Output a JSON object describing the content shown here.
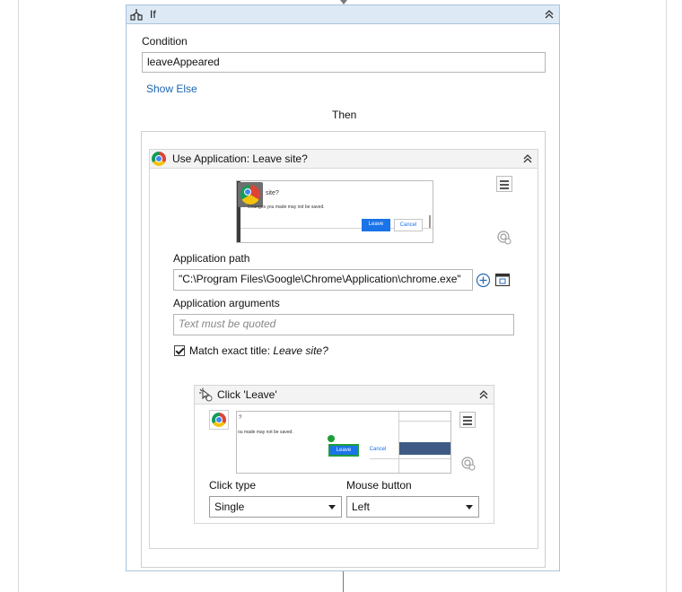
{
  "if_activity": {
    "title": "If",
    "condition_label": "Condition",
    "condition_value": "leaveAppeared",
    "show_else": "Show Else",
    "then_label": "Then"
  },
  "use_app": {
    "title": "Use Application: Leave site?",
    "preview": {
      "title_fragment": "site?",
      "message": "Changes you made may not be saved.",
      "leave": "Leave",
      "cancel": "Cancel"
    },
    "app_path_label": "Application path",
    "app_path_value": "\"C:\\Program Files\\Google\\Chrome\\Application\\chrome.exe\"",
    "app_args_label": "Application arguments",
    "app_args_placeholder": "Text must be quoted",
    "match_title_label": "Match exact title: ",
    "match_title_value": "Leave site?",
    "match_title_checked": true
  },
  "click": {
    "title": "Click 'Leave'",
    "preview": {
      "title_fragment": "?",
      "message": "ou made may not be saved.",
      "leave": "Leave",
      "cancel": "Cancel"
    },
    "click_type_label": "Click type",
    "click_type_value": "Single",
    "mouse_button_label": "Mouse button",
    "mouse_button_value": "Left"
  },
  "colors": {
    "header_bg": "#dde9f5",
    "border": "#a9c4de",
    "link": "#1a66b3",
    "leave_button": "#1a73e8",
    "target_green": "#1e9e3a"
  }
}
